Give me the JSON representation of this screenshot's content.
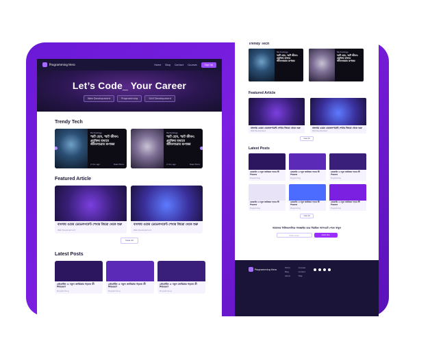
{
  "brand": "Programming Hero",
  "nav": {
    "links": [
      "Home",
      "Blog",
      "Contact",
      "Courses"
    ],
    "cta": "Sign Up"
  },
  "hero": {
    "title": "Let’s Code_ Your Career",
    "tags": [
      "Web Development",
      "Programming",
      "Skill Development"
    ]
  },
  "sections": {
    "trendy": "Trendy Tech",
    "featured": "Featured Article",
    "latest": "Latest Posts"
  },
  "trendy_cards": [
    {
      "category": "Technology",
      "text": "স্মার্ট হোম, স্মার্ট জীবন: প্রযুক্তির মাধ্যমে জীবনযাত্রার রূপান্তর",
      "date": "2 min ago",
      "more": "Read More"
    },
    {
      "category": "Technology",
      "text": "স্মার্ট হোম, স্মার্ট জীবন: প্রযুক্তির মাধ্যমে জীবনযাত্রার রূপান্তর",
      "date": "2 min ago",
      "more": "Read More"
    }
  ],
  "featured_cards": [
    {
      "text": "বাংলায় ওয়েব ডেভেলপমেন্ট শেখার জিরো থেকে শুরু",
      "meta": "Web Development"
    },
    {
      "text": "বাংলায় ওয়েব ডেভেলপমেন্ট শেখার জিরো থেকে শুরু",
      "meta": "Web Development"
    }
  ],
  "more_button": "View All",
  "latest_cards": [
    {
      "text": "প্রোগ্রামিং এ নতুন ক্যারিয়ার গড়তে কী শিখবেন?",
      "meta": "Programming"
    },
    {
      "text": "প্রোগ্রামিং এ নতুন ক্যারিয়ার গড়তে কী শিখবেন?",
      "meta": "Programming"
    },
    {
      "text": "প্রোগ্রামিং এ নতুন ক্যারিয়ার গড়তে কী শিখবেন?",
      "meta": "Programming"
    }
  ],
  "right_latest_cards": [
    {
      "text": "প্রোগ্রামিং এ নতুন ক্যারিয়ার গড়তে কী শিখবেন?",
      "meta": "Programming"
    },
    {
      "text": "প্রোগ্রামিং এ নতুন ক্যারিয়ার গড়তে কী শিখবেন?",
      "meta": "Programming"
    },
    {
      "text": "প্রোগ্রামিং এ নতুন ক্যারিয়ার গড়তে কী শিখবেন?",
      "meta": "Programming"
    },
    {
      "text": "প্রোগ্রামিং এ নতুন ক্যারিয়ার গড়তে কী শিখবেন?",
      "meta": "Programming"
    },
    {
      "text": "প্রোগ্রামিং এ নতুন ক্যারিয়ার গড়তে কী শিখবেন?",
      "meta": "Programming"
    },
    {
      "text": "প্রোগ্রামিং এ নতুন ক্যারিয়ার গড়তে কী শিখবেন?",
      "meta": "Programming"
    }
  ],
  "newsletter": {
    "text": "আমাদের নিউজলেটারে সাবস্ক্রাইব করে নিয়মিত আপডেট পেতে থাকুন",
    "placeholder": "Enter email",
    "button": "Subscribe"
  },
  "footer": {
    "brand": "Programming Hero",
    "columns": [
      [
        "Home",
        "Blog",
        "About"
      ],
      [
        "Courses",
        "Contact",
        "Help"
      ]
    ]
  },
  "colors": {
    "accent": "#7b1fe0",
    "navy": "#1a1538",
    "button": "#9c4dff"
  }
}
